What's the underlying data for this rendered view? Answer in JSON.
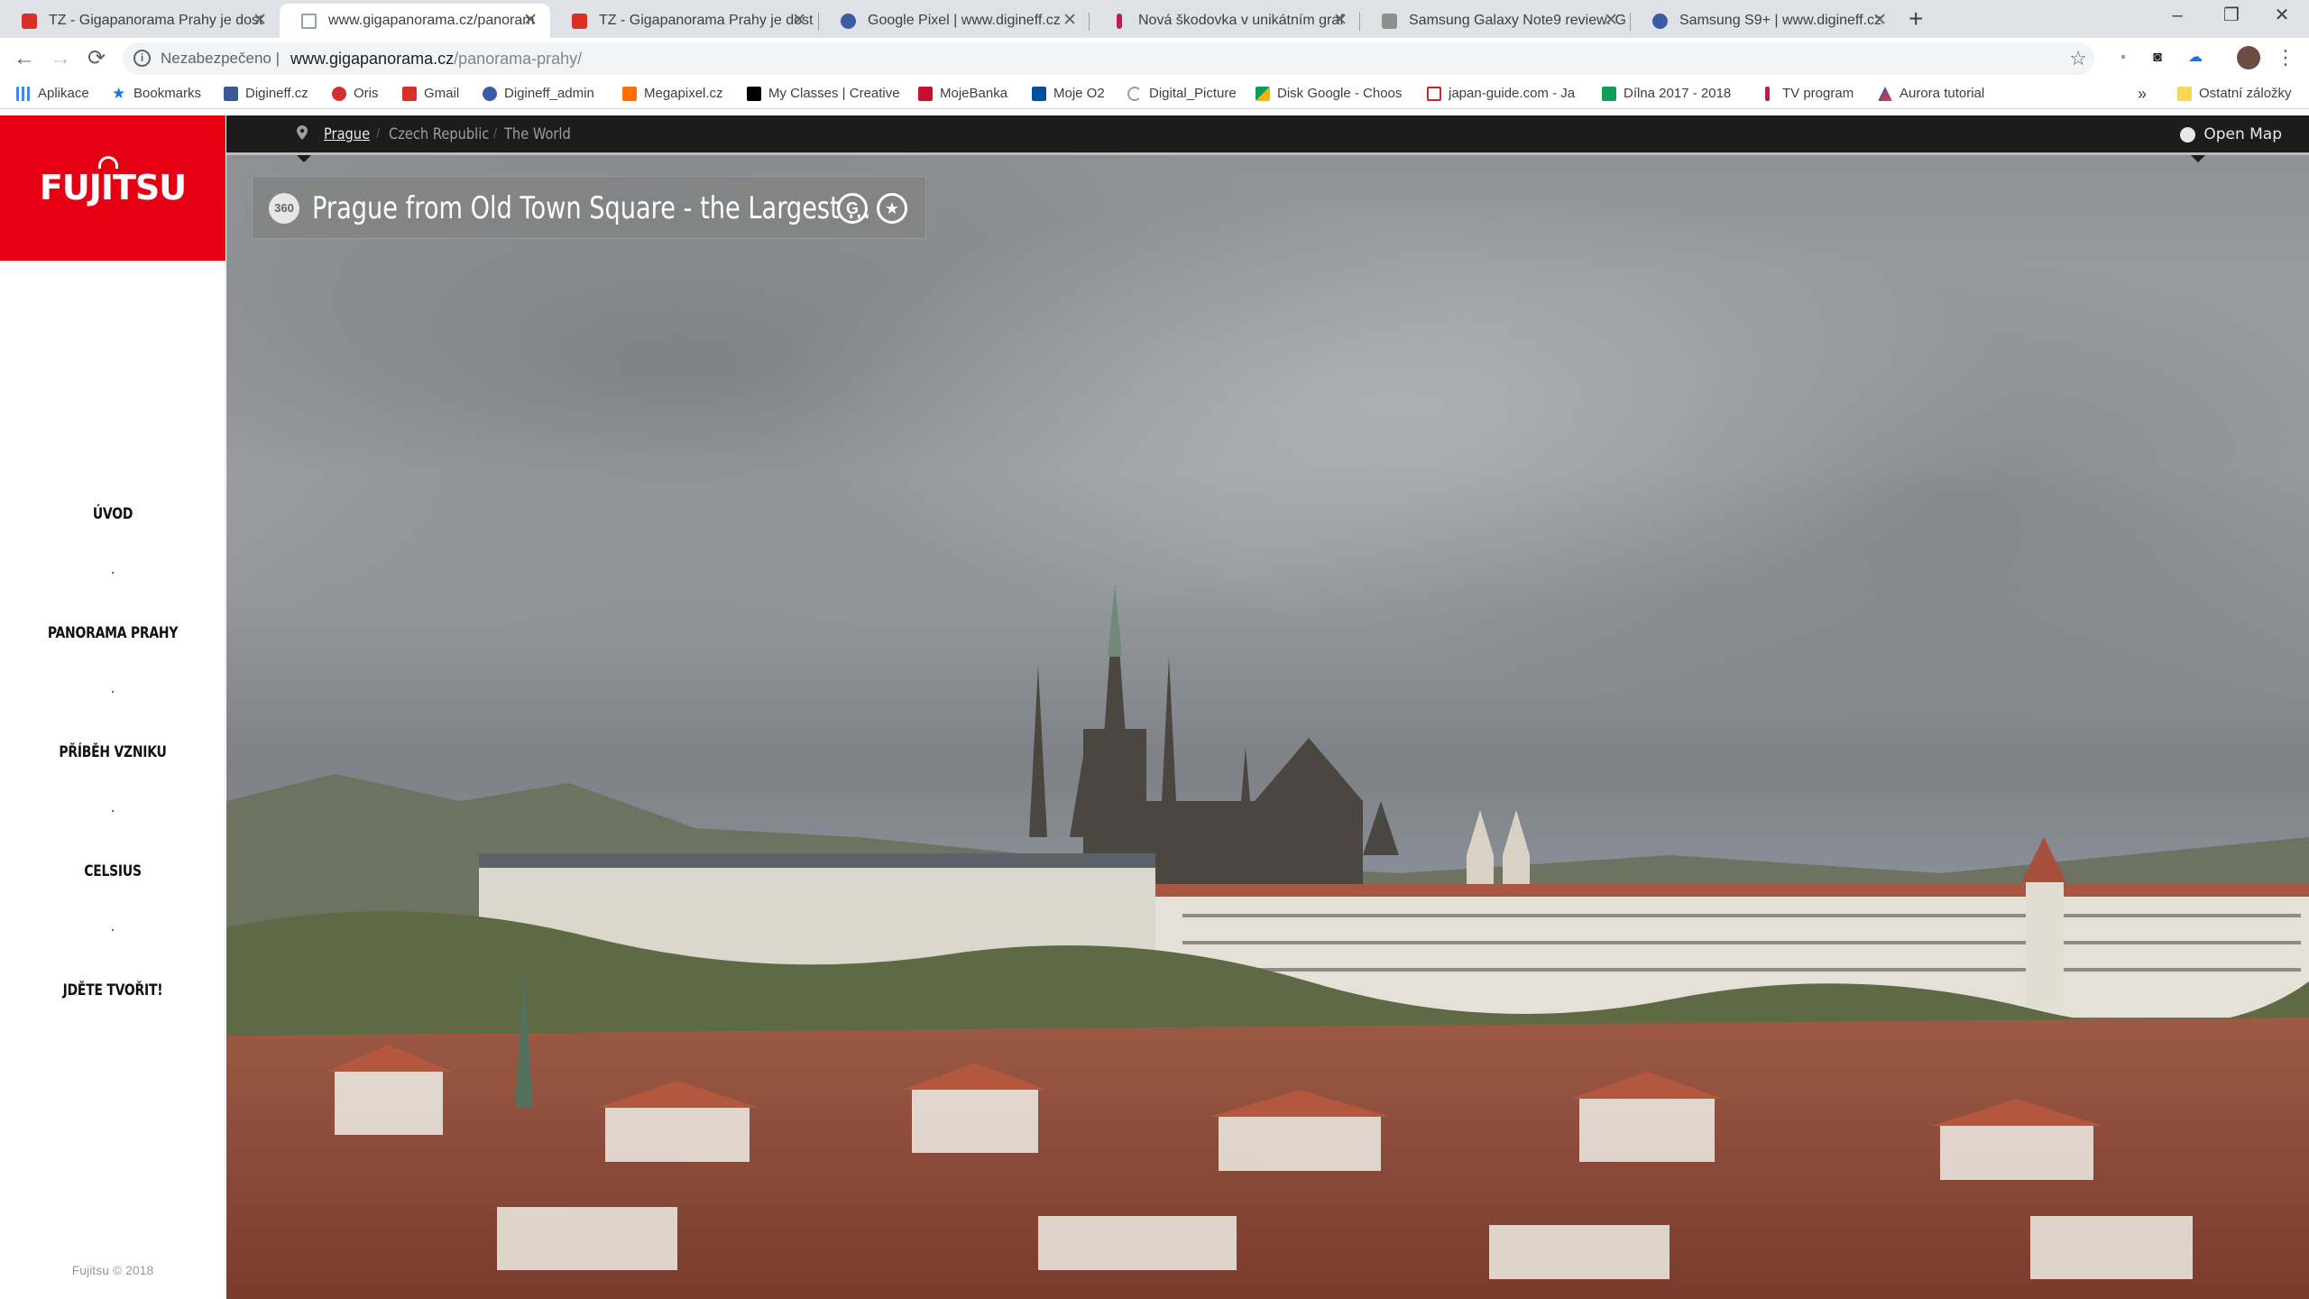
{
  "browser": {
    "tabs": [
      {
        "title": "TZ - Gigapanorama Prahy je dost",
        "favicon": "gmail-icon",
        "color": "#d93025"
      },
      {
        "title": "www.gigapanorama.cz/panoram",
        "favicon": "page-icon",
        "color": "#9aa0a6",
        "active": true
      },
      {
        "title": "TZ - Gigapanorama Prahy je dost",
        "favicon": "gmail-icon",
        "color": "#d93025"
      },
      {
        "title": "Google Pixel | www.digineff.cz",
        "favicon": "digineff-icon",
        "color": "#3b5ba5"
      },
      {
        "title": "Nová škodovka v unikátním graf",
        "favicon": "info-icon",
        "color": "#c2185b"
      },
      {
        "title": "Samsung Galaxy Note9 review: G",
        "favicon": "gsmarena-icon",
        "color": "#8e8e8e"
      },
      {
        "title": "Samsung S9+ | www.digineff.cz",
        "favicon": "digineff-icon",
        "color": "#3b5ba5"
      }
    ],
    "window_controls": {
      "minimize": "–",
      "restore": "❐",
      "close": "✕"
    },
    "new_tab": "+",
    "omnibox": {
      "security_label": "Nezabezpečeno",
      "separator": "|",
      "host": "www.gigapanorama.cz",
      "path": "/panorama-prahy/"
    },
    "bookmarks": [
      {
        "label": "Aplikace",
        "icon": "apps-icon",
        "color": "#4285f4"
      },
      {
        "label": "Bookmarks",
        "icon": "star-icon",
        "color": "#1a73e8"
      },
      {
        "label": "Digineff.cz",
        "icon": "facebook-icon",
        "color": "#3b5998"
      },
      {
        "label": "Oris",
        "icon": "oris-icon",
        "color": "#d32f2f"
      },
      {
        "label": "Gmail",
        "icon": "gmail-icon",
        "color": "#d93025"
      },
      {
        "label": "Digineff_admin",
        "icon": "digineff-icon",
        "color": "#3b5ba5"
      },
      {
        "label": "Megapixel.cz",
        "icon": "megapixel-icon",
        "color": "#ff6f00"
      },
      {
        "label": "My Classes | Creative",
        "icon": "creative-icon",
        "color": "#000000"
      },
      {
        "label": "MojeBanka",
        "icon": "bank-icon",
        "color": "#c8102e"
      },
      {
        "label": "Moje O2",
        "icon": "o2-icon",
        "color": "#0050a0"
      },
      {
        "label": "Digital_Picture",
        "icon": "loading-icon",
        "color": "#9e9e9e"
      },
      {
        "label": "Disk Google - Choos",
        "icon": "drive-icon",
        "color": "#0f9d58"
      },
      {
        "label": "japan-guide.com - Ja",
        "icon": "japan-icon",
        "color": "#c62828"
      },
      {
        "label": "Dílna 2017 - 2018",
        "icon": "sheets-icon",
        "color": "#0f9d58"
      },
      {
        "label": "TV program",
        "icon": "info-icon",
        "color": "#c2185b"
      },
      {
        "label": "Aurora tutorial",
        "icon": "aurora-icon",
        "color": "#3f51b5"
      }
    ],
    "bookmarks_more": "»",
    "other_bookmarks": "Ostatní záložky"
  },
  "sidebar": {
    "logo": "FUJITSU",
    "menu": [
      "ÚVOD",
      "PANORAMA PRAHY",
      "PŘÍBĚH VZNIKU",
      "CELSIUS",
      "JDĚTE TVOŘIT!"
    ],
    "footer": "Fujitsu © 2018"
  },
  "viewer": {
    "breadcrumb": [
      "Prague",
      "Czech Republic",
      "The World"
    ],
    "open_map": "Open Map",
    "badge": "360",
    "title": "Prague from Old Town Square - the Largest ...",
    "google_btn": "G",
    "favorite_btn": "★"
  },
  "colors": {
    "brand": "#e60012",
    "crumbbar": "#1c1c1c"
  }
}
